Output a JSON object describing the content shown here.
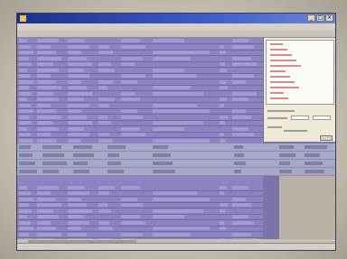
{
  "window": {
    "title": ""
  },
  "menu": {
    "items": [
      "",
      "",
      "",
      "",
      "",
      ""
    ]
  },
  "colors": {
    "grid_background": "#8c84c2",
    "selection_band": "#a8a8c8",
    "side_panel": "#efe9d8",
    "titlebar": "#1d2f8c"
  },
  "icons": [
    "app-icon",
    "minimize-icon",
    "maximize-icon",
    "close-icon"
  ]
}
